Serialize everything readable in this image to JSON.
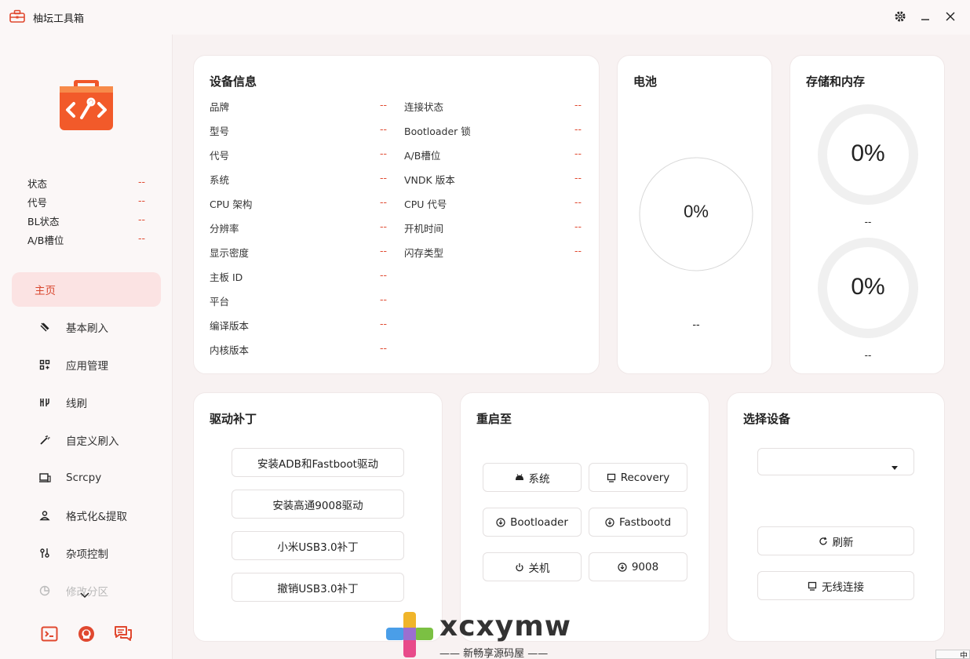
{
  "window": {
    "title": "柚坛工具箱"
  },
  "sidebar": {
    "status": [
      {
        "label": "状态",
        "value": "--"
      },
      {
        "label": "代号",
        "value": "--"
      },
      {
        "label": "BL状态",
        "value": "--"
      },
      {
        "label": "A/B槽位",
        "value": "--"
      }
    ],
    "nav": [
      {
        "label": "主页",
        "icon": "home",
        "active": true
      },
      {
        "label": "基本刷入",
        "icon": "flash-icon"
      },
      {
        "label": "应用管理",
        "icon": "apps-icon"
      },
      {
        "label": "线刷",
        "icon": "tools-icon"
      },
      {
        "label": "自定义刷入",
        "icon": "wand-icon"
      },
      {
        "label": "Scrcpy",
        "icon": "screen-icon"
      },
      {
        "label": "格式化&提取",
        "icon": "person-icon"
      },
      {
        "label": "杂项控制",
        "icon": "control-icon"
      },
      {
        "label": "修改分区",
        "icon": "pie-icon"
      }
    ],
    "bottom_icons": [
      "terminal-icon",
      "github-icon",
      "chat-icon"
    ]
  },
  "device_info": {
    "title": "设备信息",
    "left": [
      {
        "label": "品牌",
        "value": "--"
      },
      {
        "label": "型号",
        "value": "--"
      },
      {
        "label": "代号",
        "value": "--"
      },
      {
        "label": "系统",
        "value": "--"
      },
      {
        "label": "CPU 架构",
        "value": "--"
      },
      {
        "label": "分辨率",
        "value": "--"
      },
      {
        "label": "显示密度",
        "value": "--"
      },
      {
        "label": "主板 ID",
        "value": "--"
      },
      {
        "label": "平台",
        "value": "--"
      },
      {
        "label": "编译版本",
        "value": "--"
      },
      {
        "label": "内核版本",
        "value": "--"
      }
    ],
    "right": [
      {
        "label": "连接状态",
        "value": "--"
      },
      {
        "label": "Bootloader 锁",
        "value": "--"
      },
      {
        "label": "A/B槽位",
        "value": "--"
      },
      {
        "label": "VNDK 版本",
        "value": "--"
      },
      {
        "label": "CPU 代号",
        "value": "--"
      },
      {
        "label": "开机时间",
        "value": "--"
      },
      {
        "label": "闪存类型",
        "value": "--"
      }
    ]
  },
  "battery": {
    "title": "电池",
    "percent": "0%",
    "detail": "--"
  },
  "storage": {
    "title": "存储和内存",
    "storage_percent": "0%",
    "storage_detail": "--",
    "memory_percent": "0%",
    "memory_detail": "--"
  },
  "driver": {
    "title": "驱动补丁",
    "buttons": [
      "安装ADB和Fastboot驱动",
      "安装高通9008驱动",
      "小米USB3.0补丁",
      "撤销USB3.0补丁"
    ]
  },
  "reboot": {
    "title": "重启至",
    "buttons": [
      {
        "label": "系统",
        "icon": "android-icon"
      },
      {
        "label": "Recovery",
        "icon": "monitor-icon"
      },
      {
        "label": "Bootloader",
        "icon": "download-icon"
      },
      {
        "label": "Fastbootd",
        "icon": "download-icon"
      },
      {
        "label": "关机",
        "icon": "power-icon"
      },
      {
        "label": "9008",
        "icon": "download-icon"
      }
    ]
  },
  "device_select": {
    "title": "选择设备",
    "selected": "",
    "refresh": "刷新",
    "wireless": "无线连接"
  },
  "watermark": {
    "text": "xcxymw",
    "sub": "—— 新畅享源码屋 ——"
  },
  "ime": {
    "label": "中"
  },
  "colors": {
    "accent": "#e0482f",
    "active_bg": "#fbe3e3",
    "logo": "#f25a2a"
  }
}
